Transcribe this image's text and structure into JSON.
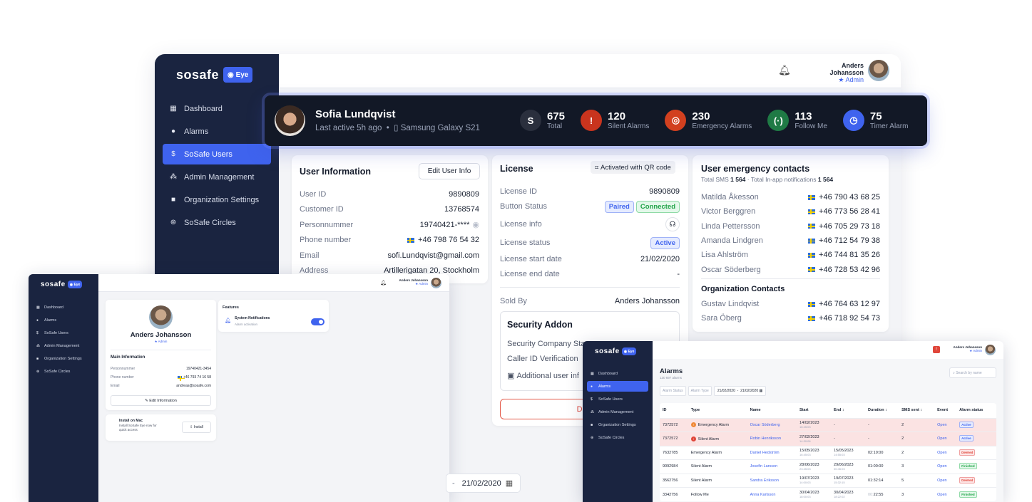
{
  "brand": {
    "logo": "sosafe",
    "badge": "Eye"
  },
  "nav": [
    {
      "label": "Dashboard",
      "icon": "dashboard-icon",
      "glyph": "▦"
    },
    {
      "label": "Alarms",
      "icon": "alarm-icon",
      "glyph": "●"
    },
    {
      "label": "SoSafe Users",
      "icon": "sosafe-icon",
      "glyph": "$",
      "active": true
    },
    {
      "label": "Admin Management",
      "icon": "admins-icon",
      "glyph": "⁂"
    },
    {
      "label": "Organization Settings",
      "icon": "briefcase-icon",
      "glyph": "■"
    },
    {
      "label": "SoSafe Circles",
      "icon": "circles-icon",
      "glyph": "⊛"
    }
  ],
  "header": {
    "user_name": "Anders Johansson",
    "role": "Admin"
  },
  "profile": {
    "name": "Sofia Lundqvist",
    "last_active": "Last active 5h ago",
    "device": "Samsung Galaxy S21",
    "stats": [
      {
        "value": "675",
        "label": "Total",
        "glyph": "S",
        "color": "#2a2f3d"
      },
      {
        "value": "120",
        "label": "Silent Alarms",
        "glyph": "!",
        "color": "#c9341e"
      },
      {
        "value": "230",
        "label": "Emergency Alarms",
        "glyph": "◎",
        "color": "#d2401f"
      },
      {
        "value": "113",
        "label": "Follow Me",
        "glyph": "(·)",
        "color": "#1f7a45"
      },
      {
        "value": "75",
        "label": "Timer Alarm",
        "glyph": "◷",
        "color": "#3f63ee"
      }
    ]
  },
  "user_info": {
    "title": "User Information",
    "edit_label": "Edit User Info",
    "rows": [
      {
        "label": "User ID",
        "value": "9890809"
      },
      {
        "label": "Customer ID",
        "value": "13768574"
      },
      {
        "label": "Personnummer",
        "value": "19740421-****"
      },
      {
        "label": "Phone number",
        "value": "+46 798 76 54 32"
      },
      {
        "label": "Email",
        "value": "sofi.Lundqvist@gmail.com"
      },
      {
        "label": "Address",
        "value": "Artillerigatan 20, Stockholm"
      }
    ]
  },
  "license": {
    "title": "License",
    "activated": "Activated with QR code",
    "license_id_label": "License ID",
    "license_id": "9890809",
    "button_status_label": "Button Status",
    "paired": "Paired",
    "connected": "Connected",
    "info_label": "License info",
    "status_label": "License status",
    "status": "Active",
    "start_label": "License start date",
    "start": "21/02/2020",
    "end_label": "License end date",
    "end": "-",
    "sold_by_label": "Sold By",
    "sold_by": "Anders Johansson",
    "addon_title": "Security Addon",
    "addon_company": "Security Company Sta",
    "addon_caller": "Caller ID Verification",
    "addon_additional": "Additional user inf",
    "deactivate": "Deactiv"
  },
  "contacts": {
    "title": "User emergency contacts",
    "totals_prefix": "Total SMS",
    "total_sms": "1 564",
    "totals_mid": "· Total In-app notifications",
    "total_inapp": "1 564",
    "list": [
      {
        "name": "Matilda Åkesson",
        "phone": "+46 790 43 68 25"
      },
      {
        "name": "Victor Berggren",
        "phone": "+46 773 56 28 41"
      },
      {
        "name": "Linda Pettersson",
        "phone": "+46 705 29 73 18"
      },
      {
        "name": "Amanda Lindgren",
        "phone": "+46 712 54 79 38"
      },
      {
        "name": "Lisa Ahlström",
        "phone": "+46 744 81 35 26"
      },
      {
        "name": "Oscar Söderberg",
        "phone": "+46 728 53 42 96"
      }
    ],
    "org_title": "Organization Contacts",
    "org_list": [
      {
        "name": "Gustav Lindqvist",
        "phone": "+46 764 63 12 97"
      },
      {
        "name": "Sara Öberg",
        "phone": "+46 718 92 54 73"
      }
    ]
  },
  "admin_profile": {
    "name": "Anders Johansson",
    "role": "Admin",
    "section": "Main Information",
    "rows": [
      {
        "label": "Personnummer",
        "value": "19740421-3454"
      },
      {
        "label": "Phone number",
        "value": "+46 793 74 16 58"
      },
      {
        "label": "Email",
        "value": "andreas@sosafe.com"
      }
    ],
    "edit_label": "Edit Information",
    "install_title": "Install on Mac",
    "install_desc1": "Install SoSafe Eye now for",
    "install_desc2": "quick access",
    "install_btn": "Install",
    "features_title": "Features",
    "feature_name": "System Notifications",
    "feature_desc": "Alarm activation",
    "date": "21/02/2020",
    "date_dash": "-"
  },
  "alarms": {
    "title": "Alarms",
    "count": "130 697 alarms",
    "search_placeholder": "Search by name",
    "filter_status": "Alarm Status",
    "filter_type": "Alarm Type",
    "date_from": "21/02/2020",
    "date_sep": "-",
    "date_to": "21/02/2020",
    "columns": [
      "ID",
      "Type",
      "Name",
      "Start",
      "End ↕",
      "Duration ↕",
      "SMS sent ↕",
      "Event",
      "Alarm status"
    ],
    "rows": [
      {
        "id": "7372572",
        "type": "Emergency Alarm",
        "name": "Oscar Söderberg",
        "start": "14/02/2023",
        "start_t": "16:45:03",
        "end": "-",
        "end_t": "",
        "duration": "-",
        "sms": "2",
        "event": "Open",
        "status": "Active",
        "alert": "emergency"
      },
      {
        "id": "7372572",
        "type": "Silent Alarm",
        "name": "Robin Henriksson",
        "start": "27/02/2023",
        "start_t": "14:30:06",
        "end": "-",
        "end_t": "",
        "duration": "-",
        "sms": "2",
        "event": "Open",
        "status": "Active",
        "alert": "silent"
      },
      {
        "id": "7632785",
        "type": "Emergency Alarm",
        "name": "Daniel Hedström",
        "start": "15/05/2023",
        "start_t": "16:45:03",
        "end": "15/05/2023",
        "end_t": "14:55:03",
        "duration": "02:10:00",
        "sms": "2",
        "event": "Open",
        "status": "Deleted"
      },
      {
        "id": "9092984",
        "type": "Silent Alarm",
        "name": "Josefin Larsson",
        "start": "28/06/2023",
        "start_t": "23:45:03",
        "end": "29/06/2023",
        "end_t": "00:45:03",
        "duration": "01:00:00",
        "sms": "3",
        "event": "Open",
        "status": "Finished"
      },
      {
        "id": "3562756",
        "type": "Silent Alarm",
        "name": "Sandra Eriksson",
        "start": "19/07/2023",
        "start_t": "14:00:03",
        "end": "19/07/2023",
        "end_t": "15:32:15",
        "duration": "01:32:14",
        "sms": "5",
        "event": "Open",
        "status": "Deleted"
      },
      {
        "id": "3342756",
        "type": "Follow Me",
        "name": "Anna Karlsson",
        "start": "30/04/2023",
        "start_t": "18:00:03",
        "end": "30/04/2023",
        "end_t": "18:22:02",
        "duration": "22:55",
        "duration_prefix": "00:",
        "sms": "3",
        "event": "Open",
        "status": "Finished"
      }
    ]
  }
}
